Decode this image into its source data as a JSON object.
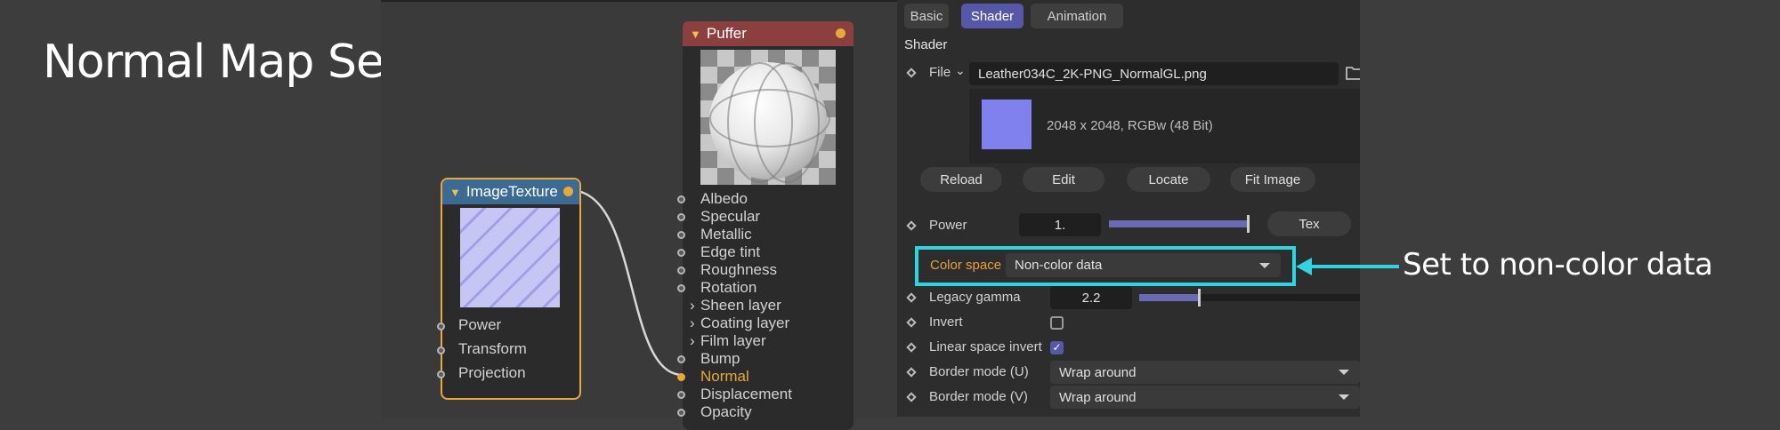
{
  "slide": {
    "title": "Normal Map Setup",
    "annotation": "Set to non-color data",
    "accent_color": "#2ed4df"
  },
  "image_texture_node": {
    "title": "ImageTexture",
    "inputs": [
      "Power",
      "Transform",
      "Projection"
    ]
  },
  "puffer_node": {
    "title": "Puffer",
    "rows": [
      {
        "label": "Albedo",
        "kind": "socket"
      },
      {
        "label": "Specular",
        "kind": "socket"
      },
      {
        "label": "Metallic",
        "kind": "socket"
      },
      {
        "label": "Edge tint",
        "kind": "socket"
      },
      {
        "label": "Roughness",
        "kind": "socket"
      },
      {
        "label": "Rotation",
        "kind": "socket"
      },
      {
        "label": "Sheen layer",
        "kind": "group"
      },
      {
        "label": "Coating layer",
        "kind": "group"
      },
      {
        "label": "Film layer",
        "kind": "group"
      },
      {
        "label": "Bump",
        "kind": "socket"
      },
      {
        "label": "Normal",
        "kind": "connected"
      },
      {
        "label": "Displacement",
        "kind": "socket"
      },
      {
        "label": "Opacity",
        "kind": "socket"
      }
    ]
  },
  "panel": {
    "tabs": [
      "Basic",
      "Shader",
      "Animation"
    ],
    "active_tab": "Shader",
    "section_title": "Shader",
    "file_label": "File",
    "file_name": "Leather034C_2K-PNG_NormalGL.png",
    "image_info": "2048 x 2048, RGBw (48 Bit)",
    "buttons": [
      "Reload",
      "Edit",
      "Locate",
      "Fit Image"
    ],
    "power_label": "Power",
    "power_value": "1.",
    "power_level": 1.0,
    "tex_button": "Tex",
    "color_space_label": "Color space",
    "color_space_value": "Non-color data",
    "legacy_gamma_label": "Legacy gamma",
    "legacy_gamma_value": "2.2",
    "invert_label": "Invert",
    "invert_checked": false,
    "linear_invert_label": "Linear space invert",
    "linear_invert_checked": true,
    "border_u_label": "Border mode (U)",
    "border_u_value": "Wrap around",
    "border_v_label": "Border mode (V)",
    "border_v_value": "Wrap around"
  }
}
